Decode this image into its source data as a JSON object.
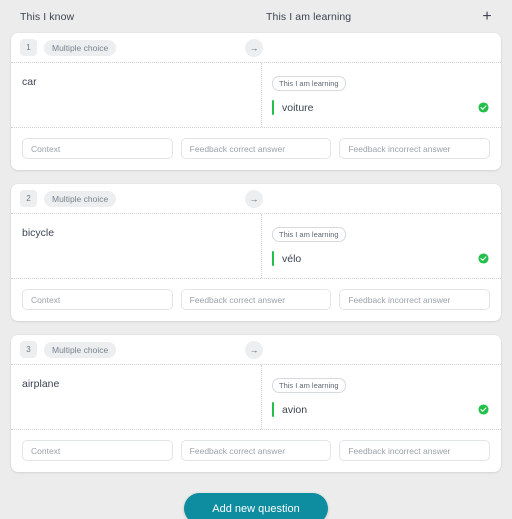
{
  "header": {
    "col_know": "This I know",
    "col_learning": "This I am learning",
    "add_icon": "plus-icon"
  },
  "cards": [
    {
      "index": "1",
      "type": "Multiple choice",
      "arrow_icon": "arrow-right-icon",
      "term": "car",
      "lang_pill": "This I am learning",
      "answer": "voiture",
      "status_icon": "check-circle-icon",
      "fields": {
        "context": "Context",
        "feedback_correct": "Feedback correct answer",
        "feedback_incorrect": "Feedback incorrect answer"
      }
    },
    {
      "index": "2",
      "type": "Multiple choice",
      "arrow_icon": "arrow-right-icon",
      "term": "bicycle",
      "lang_pill": "This I am learning",
      "answer": "vélo",
      "status_icon": "check-circle-icon",
      "fields": {
        "context": "Context",
        "feedback_correct": "Feedback correct answer",
        "feedback_incorrect": "Feedback incorrect answer"
      }
    },
    {
      "index": "3",
      "type": "Multiple choice",
      "arrow_icon": "arrow-right-icon",
      "term": "airplane",
      "lang_pill": "This I am learning",
      "answer": "avion",
      "status_icon": "check-circle-icon",
      "fields": {
        "context": "Context",
        "feedback_correct": "Feedback correct answer",
        "feedback_incorrect": "Feedback incorrect answer"
      }
    }
  ],
  "footer": {
    "add_question_label": "Add new question"
  },
  "colors": {
    "accent_teal": "#0e8ca0",
    "accent_green": "#22c04a",
    "page_bg": "#ececec",
    "card_bg": "#ffffff",
    "text": "#3c4450",
    "muted": "#9aa2ab"
  }
}
